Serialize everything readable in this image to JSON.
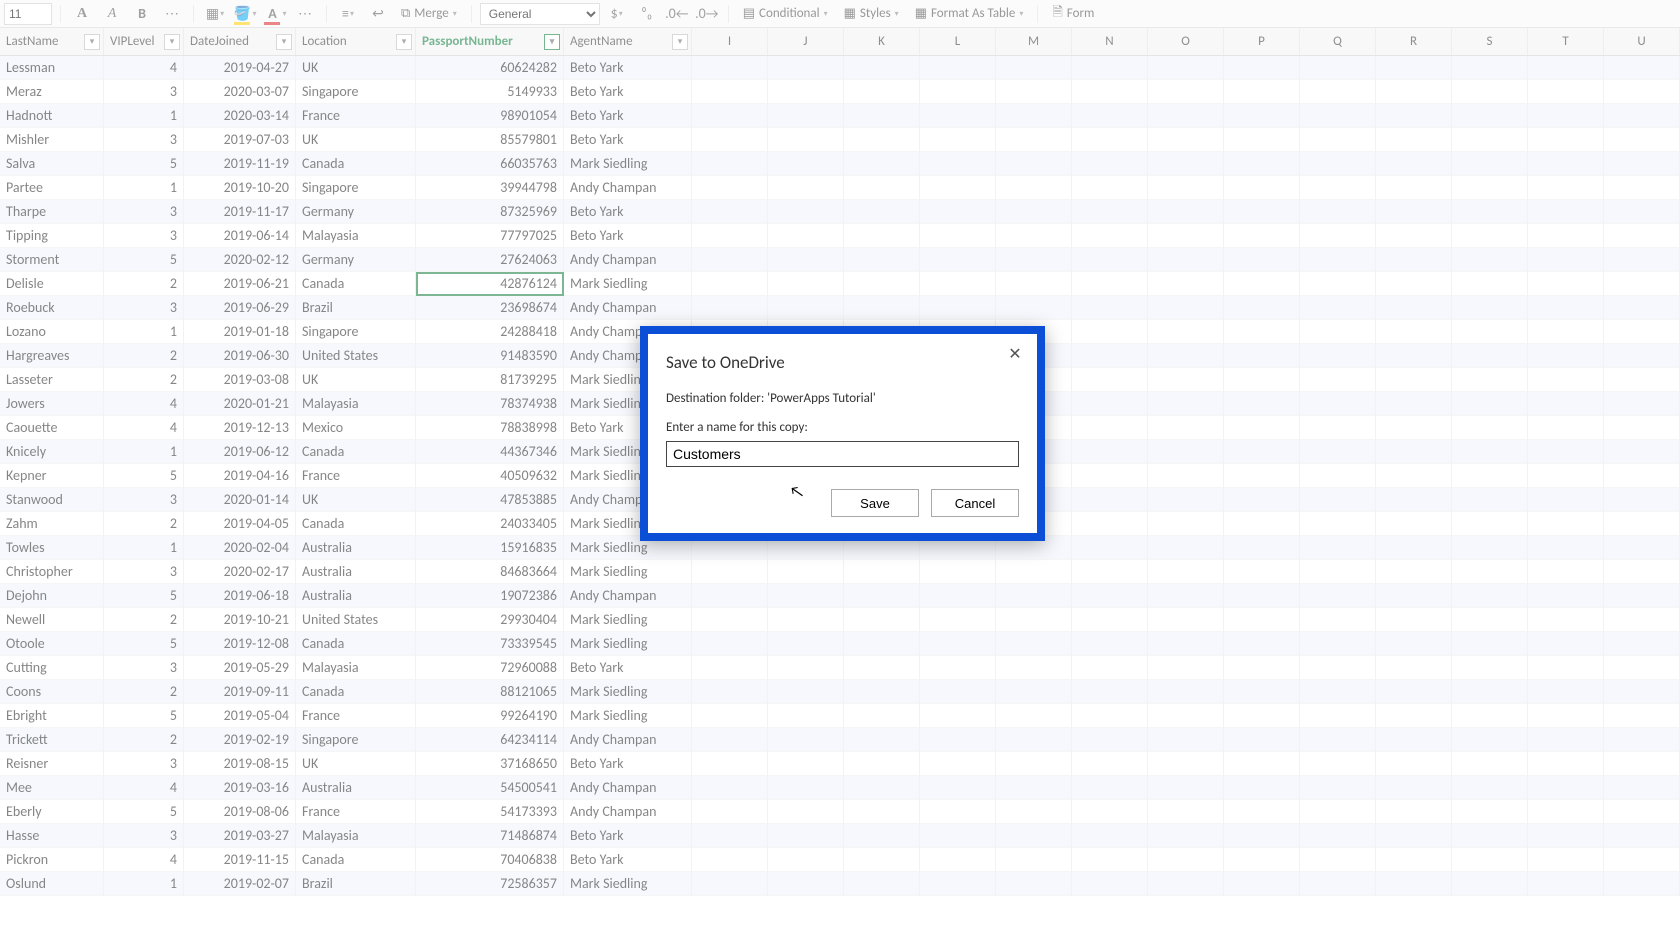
{
  "toolbar": {
    "font_size": "11",
    "merge_label": "Merge",
    "number_format": "General",
    "conditional_label": "Conditional",
    "styles_label": "Styles",
    "as_table_label": "Format As Table",
    "form_label": "Form",
    "fill_color": "#ffcc00",
    "font_color": "#d22"
  },
  "columns": {
    "widths": {
      "lastname": 104,
      "vip": 80,
      "date": 112,
      "location": 120,
      "passport": 148,
      "agent": 128,
      "letter": 76
    },
    "field_headers": [
      "LastName",
      "VIPLevel",
      "DateJoined",
      "Location",
      "PassportNumber",
      "AgentName"
    ],
    "active_header": "PassportNumber",
    "letter_headers": [
      "I",
      "J",
      "K",
      "L",
      "M",
      "N",
      "O",
      "P",
      "Q",
      "R",
      "S",
      "T",
      "U"
    ]
  },
  "rows": [
    {
      "last": "Lessman",
      "vip": 4,
      "date": "2019-04-27",
      "loc": "UK",
      "pass": "60624282",
      "agent": "Beto Yark"
    },
    {
      "last": "Meraz",
      "vip": 3,
      "date": "2020-03-07",
      "loc": "Singapore",
      "pass": "5149933",
      "agent": "Beto Yark"
    },
    {
      "last": "Hadnott",
      "vip": 1,
      "date": "2020-03-14",
      "loc": "France",
      "pass": "98901054",
      "agent": "Beto Yark"
    },
    {
      "last": "Mishler",
      "vip": 3,
      "date": "2019-07-03",
      "loc": "UK",
      "pass": "85579801",
      "agent": "Beto Yark"
    },
    {
      "last": "Salva",
      "vip": 5,
      "date": "2019-11-19",
      "loc": "Canada",
      "pass": "66035763",
      "agent": "Mark Siedling"
    },
    {
      "last": "Partee",
      "vip": 1,
      "date": "2019-10-20",
      "loc": "Singapore",
      "pass": "39944798",
      "agent": "Andy Champan"
    },
    {
      "last": "Tharpe",
      "vip": 3,
      "date": "2019-11-17",
      "loc": "Germany",
      "pass": "87325969",
      "agent": "Beto Yark"
    },
    {
      "last": "Tipping",
      "vip": 3,
      "date": "2019-06-14",
      "loc": "Malayasia",
      "pass": "77797025",
      "agent": "Beto Yark"
    },
    {
      "last": "Storment",
      "vip": 5,
      "date": "2020-02-12",
      "loc": "Germany",
      "pass": "27624063",
      "agent": "Andy Champan"
    },
    {
      "last": "Delisle",
      "vip": 2,
      "date": "2019-06-21",
      "loc": "Canada",
      "pass": "42876124",
      "agent": "Mark Siedling"
    },
    {
      "last": "Roebuck",
      "vip": 3,
      "date": "2019-06-29",
      "loc": "Brazil",
      "pass": "23698674",
      "agent": "Andy Champan"
    },
    {
      "last": "Lozano",
      "vip": 1,
      "date": "2019-01-18",
      "loc": "Singapore",
      "pass": "24288418",
      "agent": "Andy Champan"
    },
    {
      "last": "Hargreaves",
      "vip": 2,
      "date": "2019-06-30",
      "loc": "United States",
      "pass": "91483590",
      "agent": "Andy Champan"
    },
    {
      "last": "Lasseter",
      "vip": 2,
      "date": "2019-03-08",
      "loc": "UK",
      "pass": "81739295",
      "agent": "Mark Siedling"
    },
    {
      "last": "Jowers",
      "vip": 4,
      "date": "2020-01-21",
      "loc": "Malayasia",
      "pass": "78374938",
      "agent": "Mark Siedling"
    },
    {
      "last": "Caouette",
      "vip": 4,
      "date": "2019-12-13",
      "loc": "Mexico",
      "pass": "78838998",
      "agent": "Beto Yark"
    },
    {
      "last": "Knicely",
      "vip": 1,
      "date": "2019-06-12",
      "loc": "Canada",
      "pass": "44367346",
      "agent": "Mark Siedling"
    },
    {
      "last": "Kepner",
      "vip": 5,
      "date": "2019-04-16",
      "loc": "France",
      "pass": "40509632",
      "agent": "Mark Siedling"
    },
    {
      "last": "Stanwood",
      "vip": 3,
      "date": "2020-01-14",
      "loc": "UK",
      "pass": "47853885",
      "agent": "Andy Champan"
    },
    {
      "last": "Zahm",
      "vip": 2,
      "date": "2019-04-05",
      "loc": "Canada",
      "pass": "24033405",
      "agent": "Mark Siedling"
    },
    {
      "last": "Towles",
      "vip": 1,
      "date": "2020-02-04",
      "loc": "Australia",
      "pass": "15916835",
      "agent": "Mark Siedling"
    },
    {
      "last": "Christopher",
      "vip": 3,
      "date": "2020-02-17",
      "loc": "Australia",
      "pass": "84683664",
      "agent": "Mark Siedling"
    },
    {
      "last": "Dejohn",
      "vip": 5,
      "date": "2019-06-18",
      "loc": "Australia",
      "pass": "19072386",
      "agent": "Andy Champan"
    },
    {
      "last": "Newell",
      "vip": 2,
      "date": "2019-10-21",
      "loc": "United States",
      "pass": "29930404",
      "agent": "Mark Siedling"
    },
    {
      "last": "Otoole",
      "vip": 5,
      "date": "2019-12-08",
      "loc": "Canada",
      "pass": "73339545",
      "agent": "Mark Siedling"
    },
    {
      "last": "Cutting",
      "vip": 3,
      "date": "2019-05-29",
      "loc": "Malayasia",
      "pass": "72960088",
      "agent": "Beto Yark"
    },
    {
      "last": "Coons",
      "vip": 2,
      "date": "2019-09-11",
      "loc": "Canada",
      "pass": "88121065",
      "agent": "Mark Siedling"
    },
    {
      "last": "Ebright",
      "vip": 5,
      "date": "2019-05-04",
      "loc": "France",
      "pass": "99264190",
      "agent": "Mark Siedling"
    },
    {
      "last": "Trickett",
      "vip": 2,
      "date": "2019-02-19",
      "loc": "Singapore",
      "pass": "64234114",
      "agent": "Andy Champan"
    },
    {
      "last": "Reisner",
      "vip": 3,
      "date": "2019-08-15",
      "loc": "UK",
      "pass": "37168650",
      "agent": "Beto Yark"
    },
    {
      "last": "Mee",
      "vip": 4,
      "date": "2019-03-16",
      "loc": "Australia",
      "pass": "54500541",
      "agent": "Andy Champan"
    },
    {
      "last": "Eberly",
      "vip": 5,
      "date": "2019-08-06",
      "loc": "France",
      "pass": "54173393",
      "agent": "Andy Champan"
    },
    {
      "last": "Hasse",
      "vip": 3,
      "date": "2019-03-27",
      "loc": "Malayasia",
      "pass": "71486874",
      "agent": "Beto Yark"
    },
    {
      "last": "Pickron",
      "vip": 4,
      "date": "2019-11-15",
      "loc": "Canada",
      "pass": "70406838",
      "agent": "Beto Yark"
    },
    {
      "last": "Oslund",
      "vip": 1,
      "date": "2019-02-07",
      "loc": "Brazil",
      "pass": "72586357",
      "agent": "Mark Siedling"
    }
  ],
  "selected_row_index": 9,
  "dialog": {
    "title": "Save to OneDrive",
    "dest_prefix": "Destination folder: ",
    "dest_folder": "'PowerApps Tutorial'",
    "prompt": "Enter a name for this copy:",
    "input_value": "Customers",
    "save_label": "Save",
    "cancel_label": "Cancel"
  }
}
